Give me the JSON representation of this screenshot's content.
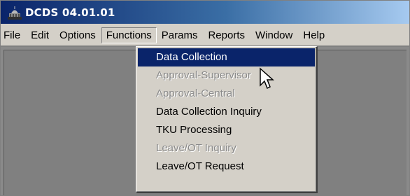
{
  "window": {
    "title": "DCDS 04.01.01",
    "icon": "capitol-building-icon"
  },
  "menubar": {
    "items": [
      "File",
      "Edit",
      "Options",
      "Functions",
      "Params",
      "Reports",
      "Window",
      "Help"
    ],
    "active": "Functions"
  },
  "functions_menu": {
    "items": [
      {
        "label": "Data Collection",
        "state": "highlighted"
      },
      {
        "label": "Approval-Supervisor",
        "state": "disabled"
      },
      {
        "label": "Approval-Central",
        "state": "disabled"
      },
      {
        "label": "Data Collection Inquiry",
        "state": "enabled"
      },
      {
        "label": "TKU Processing",
        "state": "enabled"
      },
      {
        "label": "Leave/OT Inquiry",
        "state": "disabled"
      },
      {
        "label": "Leave/OT Request",
        "state": "enabled"
      }
    ]
  },
  "colors": {
    "titlebar_start": "#0a246a",
    "titlebar_end": "#a6caf0",
    "menu_face": "#d4d0c8",
    "highlight": "#0a246a",
    "disabled_text": "#8a8a8a",
    "workspace": "#808080"
  }
}
